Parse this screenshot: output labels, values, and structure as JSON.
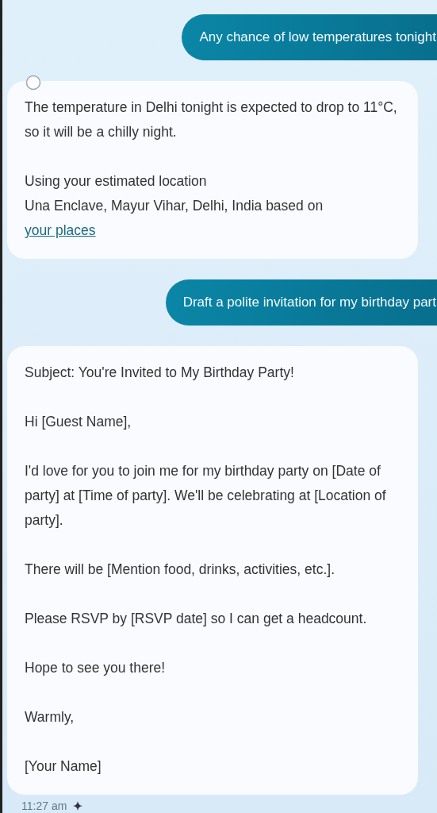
{
  "messages": [
    {
      "kind": "user",
      "text": "Any chance of low temperatures tonight"
    },
    {
      "kind": "assistant",
      "paragraphs": [
        {
          "lines": [
            "The temperature in Delhi tonight is expected to drop to 11°C, so it will be a chilly night."
          ]
        },
        {
          "lines": [
            "Using your estimated location",
            "Una Enclave, Mayur Vihar, Delhi, India based on"
          ],
          "link": "your places"
        }
      ]
    },
    {
      "kind": "user",
      "text": "Draft a polite invitation for my birthday part"
    },
    {
      "kind": "assistant",
      "paragraphs": [
        {
          "lines": [
            "Subject: You're Invited to My Birthday Party!"
          ]
        },
        {
          "lines": [
            "Hi [Guest Name],"
          ]
        },
        {
          "lines": [
            "I'd love for you to join me for my birthday party on [Date of party] at [Time of party]. We'll be celebrating at [Location of party]."
          ]
        },
        {
          "lines": [
            "There will be [Mention food, drinks, activities, etc.]."
          ]
        },
        {
          "lines": [
            "Please RSVP by [RSVP date] so I can get a headcount."
          ]
        },
        {
          "lines": [
            "Hope to see you there!"
          ]
        },
        {
          "lines": [
            "Warmly,"
          ]
        },
        {
          "lines": [
            "[Your Name]"
          ]
        }
      ]
    }
  ],
  "timestamp": "11:27 am"
}
